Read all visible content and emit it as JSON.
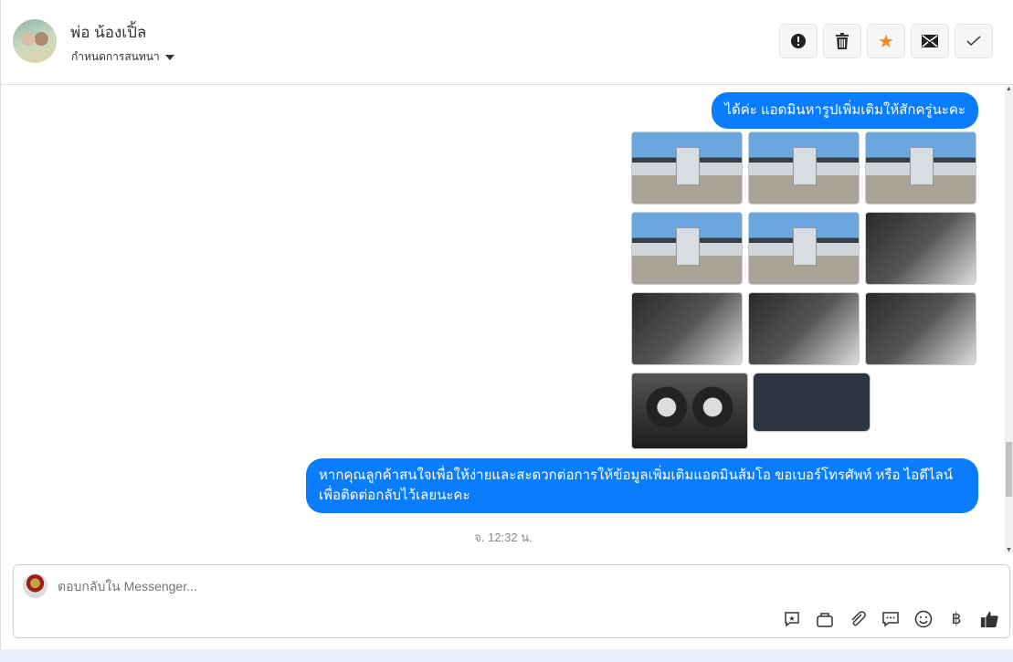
{
  "header": {
    "contact_name": "พ่อ น้องเปิ้ล",
    "conversation_settings": "กำหนดการสนทนา",
    "actions": [
      {
        "icon": "alert-icon"
      },
      {
        "icon": "trash-icon"
      },
      {
        "icon": "star-icon",
        "color": "#f5891f"
      },
      {
        "icon": "mail-icon"
      },
      {
        "icon": "check-icon"
      }
    ]
  },
  "messages": [
    {
      "text": "ได้ค่ะ แอดมินหารูปเพิ่มเติมให้สักครู่นะคะ"
    },
    {
      "text": "หากคุณลูกค้าสนใจเพื่อให้ง่ายและสะดวกต่อการให้ข้อมูลเพิ่มเติมแอดมินส้มโอ ขอเบอร์โทรศัพท์ หรือ ไอดีไลน์ เพื่อติดต่อกลับไว้เลยนะคะ"
    }
  ],
  "photo_count": 11,
  "timestamp": "จ. 12:32 น.",
  "composer": {
    "placeholder": "ตอบกลับใน Messenger..."
  },
  "colors": {
    "bubble": "#0a7cff"
  }
}
